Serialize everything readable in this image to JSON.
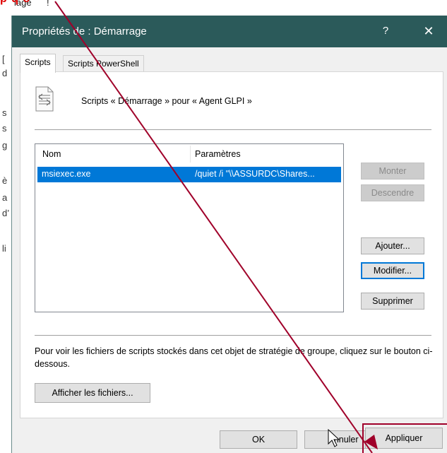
{
  "background": {
    "menu_fragment_1": "lage",
    "menu_fragment_2": "!",
    "annotation_text": "p q́ o",
    "left_glyphs": [
      "[",
      "d",
      "s",
      "s",
      "g",
      "è",
      "a",
      "d’",
      "li"
    ]
  },
  "dialog": {
    "title": "Propriétés de : Démarrage",
    "help_symbol": "?",
    "close_symbol": "✕",
    "tabs": [
      {
        "label": "Scripts",
        "selected": true
      },
      {
        "label": "Scripts PowerShell",
        "selected": false
      }
    ],
    "heading": "Scripts « Démarrage » pour « Agent GLPI »",
    "list": {
      "columns": [
        "Nom",
        "Paramètres"
      ],
      "rows": [
        {
          "name": "msiexec.exe",
          "params": "/quiet /i \"\\\\ASSURDC\\Shares..."
        }
      ]
    },
    "side_buttons": {
      "monter": "Monter",
      "descendre": "Descendre",
      "ajouter": "Ajouter...",
      "modifier": "Modifier...",
      "supprimer": "Supprimer"
    },
    "info_text": "Pour voir les fichiers de scripts stockés dans cet objet de stratégie de groupe, cliquez sur le bouton ci-dessous.",
    "show_files_button": "Afficher les fichiers...",
    "footer_buttons": {
      "ok": "OK",
      "annuler": "Annuler",
      "appliquer": "Appliquer"
    }
  },
  "colors": {
    "titlebar": "#2b5a5a",
    "selection": "#0078d7",
    "annotation": "#a0002a"
  }
}
